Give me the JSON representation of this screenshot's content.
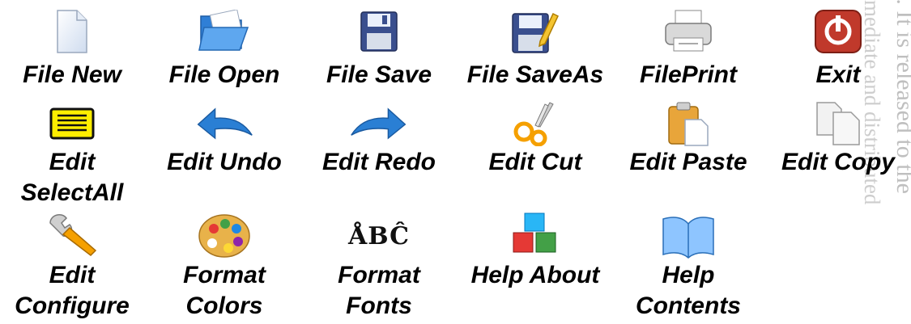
{
  "toolbar_icons": [
    {
      "label": "File New",
      "icon": "file-new-icon"
    },
    {
      "label": "File Open",
      "icon": "file-open-icon"
    },
    {
      "label": "File Save",
      "icon": "file-save-icon"
    },
    {
      "label": "File SaveAs",
      "icon": "file-saveas-icon"
    },
    {
      "label": "FilePrint",
      "icon": "file-print-icon"
    },
    {
      "label": "Exit",
      "icon": "exit-icon"
    },
    {
      "label": "Edit\nSelectAll",
      "icon": "edit-selectall-icon"
    },
    {
      "label": "Edit Undo",
      "icon": "edit-undo-icon"
    },
    {
      "label": "Edit Redo",
      "icon": "edit-redo-icon"
    },
    {
      "label": "Edit Cut",
      "icon": "edit-cut-icon"
    },
    {
      "label": "Edit Paste",
      "icon": "edit-paste-icon"
    },
    {
      "label": "Edit Copy",
      "icon": "edit-copy-icon"
    },
    {
      "label": "Edit\nConfigure",
      "icon": "edit-configure-icon"
    },
    {
      "label": "Format\nColors",
      "icon": "format-colors-icon"
    },
    {
      "label": "Format\nFonts",
      "icon": "format-fonts-icon",
      "glyph": "ÅBĈ"
    },
    {
      "label": "Help About",
      "icon": "help-about-icon"
    },
    {
      "label": "Help\nContents",
      "icon": "help-contents-icon"
    }
  ],
  "watermark": {
    "line1": "l.  It is released to the",
    "line2": "mediate and distributed"
  },
  "colors": {
    "blue_arrow": "#2a7fd4",
    "exit_red": "#c0392b",
    "selectall_yellow": "#ffee00",
    "scissors_orange": "#f5a000"
  }
}
